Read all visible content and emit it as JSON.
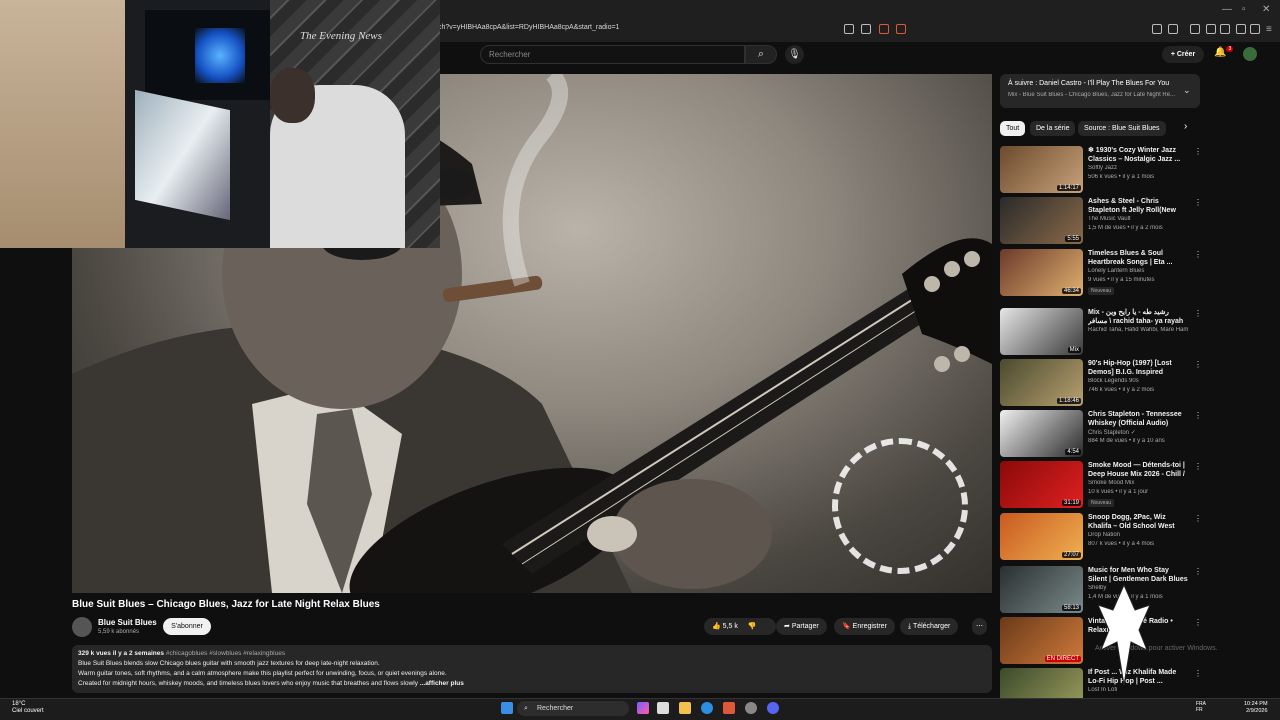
{
  "browser": {
    "url": "tch?v=yHIBHAa8cpA&list=RDyHIBHAa8cpA&start_radio=1"
  },
  "header": {
    "search_placeholder": "Rechercher",
    "create_label": "Créer",
    "notifications_count": "3"
  },
  "up_next": {
    "title": "À suivre : Daniel Castro - I'll Play The Blues For You",
    "subtitle": "Mix - Blue Suit Blues - Chicago Blues, Jazz for Late Night Re..."
  },
  "chips": [
    "Tout",
    "De la série",
    "Source : Blue Suit Blues"
  ],
  "recommendations": [
    {
      "title": "❄ 1930's Cozy Winter Jazz Classics – Nostalgic Jazz ...",
      "channel": "Softly Jazz",
      "meta": "506 k vues • il y a 1 mois",
      "duration": "1:14:17",
      "badge": "",
      "color1": "#6b4a2e",
      "color2": "#c9a27a"
    },
    {
      "title": "Ashes & Steel - Chris Stapleton ft Jelly Roll(New 2025 Music ...",
      "channel": "The Music Vault",
      "meta": "1,5 M de vues • il y a 2 mois",
      "duration": "5:55",
      "badge": "",
      "color1": "#2a2a2a",
      "color2": "#8a6a4a"
    },
    {
      "title": "Timeless Blues & Soul Heartbreak Songs | Eta ...",
      "channel": "Lonely Lantern Blues",
      "meta": "9 vues • il y a 15 minutes",
      "duration": "46:34",
      "badge": "Nouveau",
      "color1": "#6b3a2a",
      "color2": "#e0b070"
    },
    {
      "title": "Mix - رشید طه - يا رايح وين مسافر \\ rachid taha- ya rayah",
      "channel": "Rachid Taha, Hafid Wahbi, Mare Hamida...",
      "meta": "",
      "duration": "Mix",
      "badge": "",
      "color1": "#e6e6e6",
      "color2": "#3a3a3a"
    },
    {
      "title": "90's Hip-Hop (1997) [Lost Demos] B.I.G. Inspired Tribute ...",
      "channel": "Block Legends 90s",
      "meta": "746 k vues • il y a 2 mois",
      "duration": "1:18:46",
      "badge": "",
      "color1": "#4a4a2e",
      "color2": "#b8a070"
    },
    {
      "title": "Chris Stapleton - Tennessee Whiskey (Official Audio)",
      "channel": "Chris Stapleton ✓",
      "meta": "884 M de vues • il y a 10 ans",
      "duration": "4:54",
      "badge": "",
      "color1": "#f0f0f0",
      "color2": "#2a2a2a"
    },
    {
      "title": "Smoke Mood — Détends-toi | Deep House Mix 2026 - Chill / ...",
      "channel": "Smoke Mood Mix",
      "meta": "10 k vues • il y a 1 jour",
      "duration": "31:19",
      "badge": "Nouveau",
      "color1": "#8a0a0a",
      "color2": "#e02020"
    },
    {
      "title": "Snoop Dogg, 2Pac, Wiz Khalifa – Old School West Coast Rap ...",
      "channel": "Drop Nation",
      "meta": "807 k vues • il y a 4 mois",
      "duration": "27:07",
      "badge": "",
      "color1": "#c85a20",
      "color2": "#f0b050"
    },
    {
      "title": "Music for Men Who Stay Silent | Gentlemen Dark Blues",
      "channel": "Shelby",
      "meta": "1,4 M de vues • il y a 1 mois",
      "duration": "58:13",
      "badge": "",
      "color1": "#2a2f30",
      "color2": "#7a8a8a"
    },
    {
      "title": "Vintage Jazz Café Radio • Relaxing & ...",
      "channel": "",
      "meta": "",
      "duration": "EN DIRECT",
      "badge": "",
      "color1": "#6a3a1a",
      "color2": "#d07a3a"
    },
    {
      "title": "If Post ... Wiz Khalifa Made Lo-Fi Hip Hop | Post ...",
      "channel": "Lost In Lofi",
      "meta": "",
      "duration": "",
      "badge": "",
      "color1": "#3a4a2a",
      "color2": "#a0a060"
    }
  ],
  "video": {
    "title": "Blue Suit Blues – Chicago Blues, Jazz for Late Night Relax Blues",
    "channel": "Blue Suit Blues",
    "subscribers": "5,59 k abonnés",
    "subscribe_label": "S'abonner",
    "likes": "5,5 k",
    "share_label": "Partager",
    "save_label": "Enregistrer",
    "download_label": "Télécharger",
    "more_label": "⋯"
  },
  "description": {
    "stats": "329 k vues  il y a 2 semaines",
    "hashtags": "#chicagoblues #slowblues #relaxingblues",
    "line1": "Blue Suit Blues blends slow Chicago blues guitar with smooth jazz textures for deep late-night relaxation.",
    "line2": "Warm guitar tones, soft rhythms, and a calm atmosphere make this playlist perfect for unwinding, focus, or quiet evenings alone.",
    "line3": "Created for midnight hours, whiskey moods, and timeless blues lovers who enjoy music that breathes and flows slowly",
    "more": " ...afficher plus"
  },
  "watermark": "Activer Windows pour activer Windows.",
  "webcam": {
    "newspaper": "The Evening News"
  },
  "taskbar": {
    "temperature": "18°C",
    "weather": "Ciel couvert",
    "search_label": "Rechercher",
    "lang1": "FRA",
    "lang2": "FR",
    "time": "10:24 PM",
    "date": "2/9/2026"
  }
}
